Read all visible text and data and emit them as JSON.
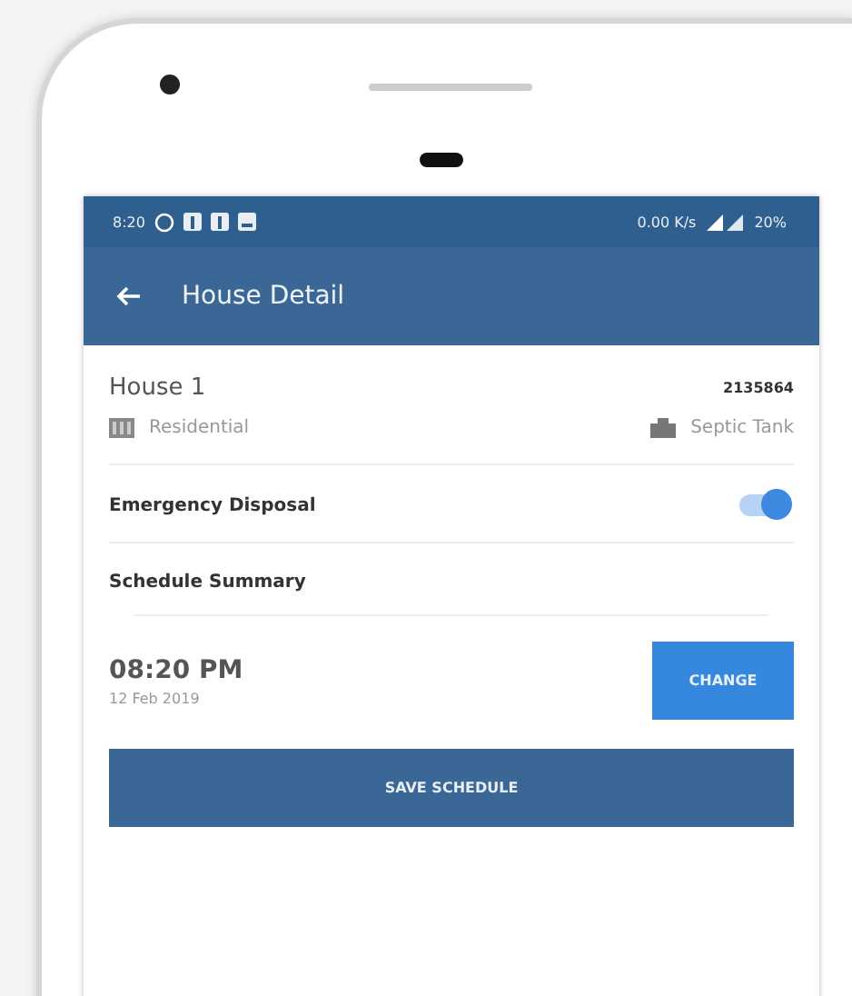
{
  "status_bar": {
    "time": "8:20",
    "speed": "0.00 K/s",
    "battery": "20%"
  },
  "app_bar": {
    "title": "House Detail"
  },
  "house": {
    "name": "House 1",
    "id": "2135864",
    "type": "Residential",
    "tank": "Septic Tank"
  },
  "emergency_disposal": {
    "label": "Emergency Disposal",
    "on": true
  },
  "schedule": {
    "heading": "Schedule Summary",
    "time": "08:20 PM",
    "date": "12 Feb 2019",
    "change_button": "CHANGE"
  },
  "save_button": "SAVE SCHEDULE"
}
